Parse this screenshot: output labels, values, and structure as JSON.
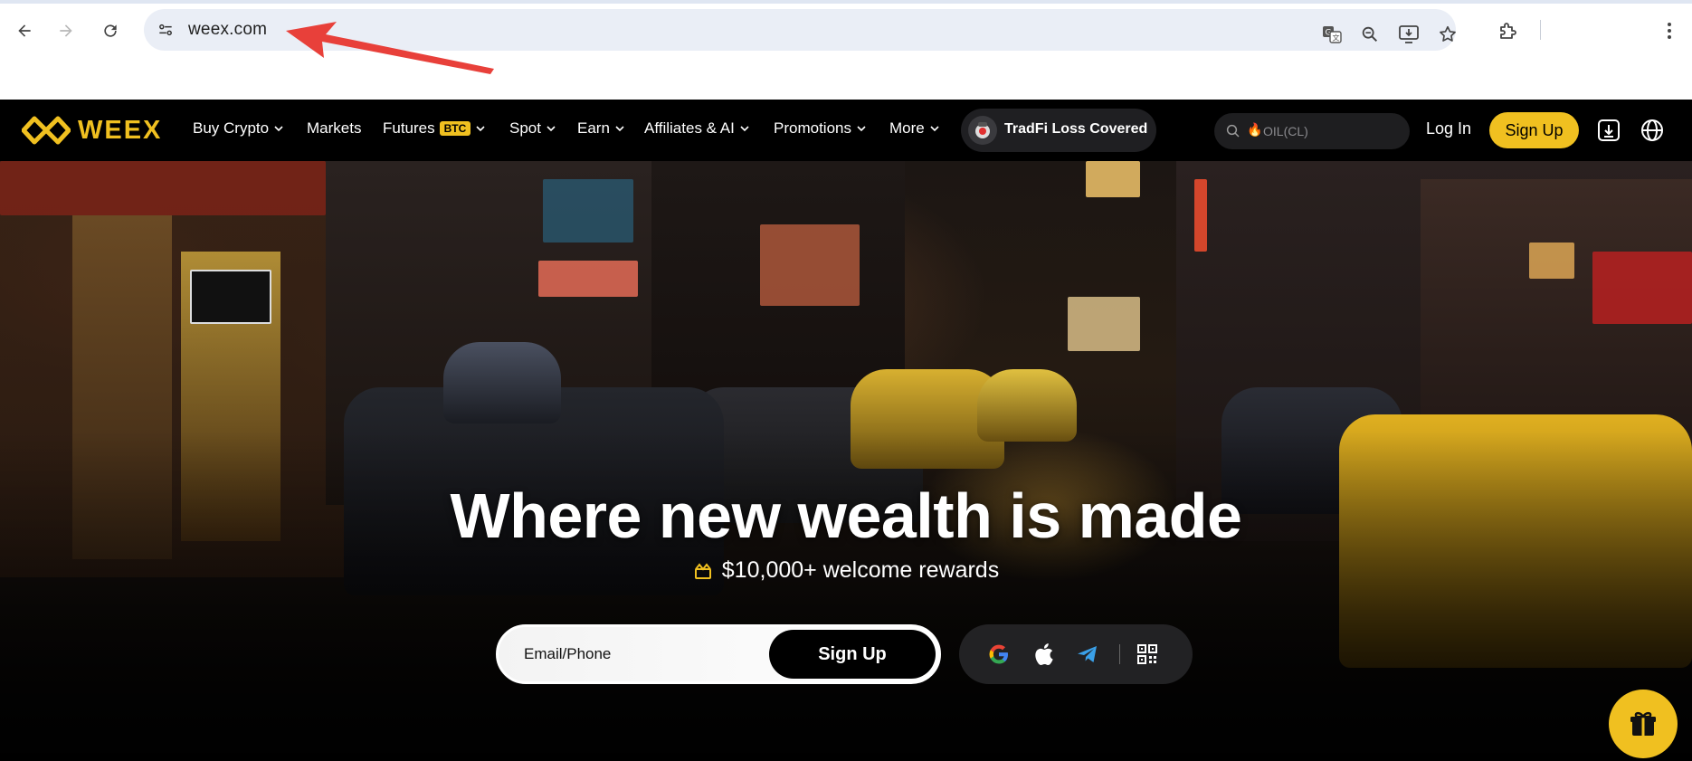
{
  "browser": {
    "url": "weex.com",
    "back_icon": "arrow-left-icon",
    "forward_icon": "arrow-right-icon",
    "reload_icon": "reload-icon",
    "toolbar_icons": [
      "translate-icon",
      "zoom-icon",
      "install-app-icon",
      "bookmark-star-icon",
      "extensions-icon",
      "menu-kebab-icon"
    ]
  },
  "site_nav": {
    "logo_text": "WEEX",
    "items": [
      {
        "label": "Buy Crypto",
        "dropdown": true
      },
      {
        "label": "Markets",
        "dropdown": false
      },
      {
        "label": "Futures",
        "badge": "BTC",
        "dropdown": true
      },
      {
        "label": "Spot",
        "dropdown": true
      },
      {
        "label": "Earn",
        "dropdown": true
      },
      {
        "label": "Affiliates & AI",
        "dropdown": true
      },
      {
        "label": "Promotions",
        "dropdown": true
      },
      {
        "label": "More",
        "dropdown": true
      }
    ],
    "promo_pill": "TradFi Loss Covered",
    "search_placeholder": "OIL(CL)",
    "login": "Log In",
    "signup": "Sign Up"
  },
  "hero": {
    "headline": "Where new wealth is made",
    "rewards": "$10,000+ welcome rewards",
    "email_placeholder": "Email/Phone",
    "signup_button": "Sign Up",
    "social_logins": [
      "google-icon",
      "apple-icon",
      "telegram-icon",
      "qr-code-icon"
    ]
  },
  "colors": {
    "brand_yellow": "#f0c020",
    "nav_bg": "#000000",
    "annotation_red": "#e8403a"
  }
}
